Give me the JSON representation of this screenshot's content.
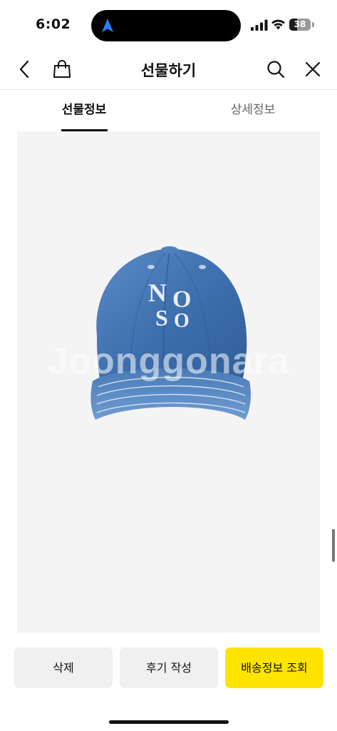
{
  "status_bar": {
    "time": "6:02",
    "battery_level": "38",
    "battery_fraction": 0.38,
    "icons": [
      "location-arrow-icon",
      "signal-icon",
      "wifi-icon",
      "battery-icon"
    ]
  },
  "header": {
    "title": "선물하기",
    "icons": [
      "back-chevron-icon",
      "shopping-bag-icon",
      "search-icon",
      "close-icon"
    ]
  },
  "tabs": [
    {
      "label": "선물정보",
      "selected": true
    },
    {
      "label": "상세정보",
      "selected": false
    }
  ],
  "product": {
    "logo_text": "NO SO",
    "watermark": "Joonggonara"
  },
  "actions": {
    "delete": "삭제",
    "write_review": "후기 작성",
    "track_shipping": "배송정보 조회"
  },
  "colors": {
    "accent": "#ffe400",
    "image_background": "#f4f4f4",
    "denim": "#3e6fae"
  }
}
